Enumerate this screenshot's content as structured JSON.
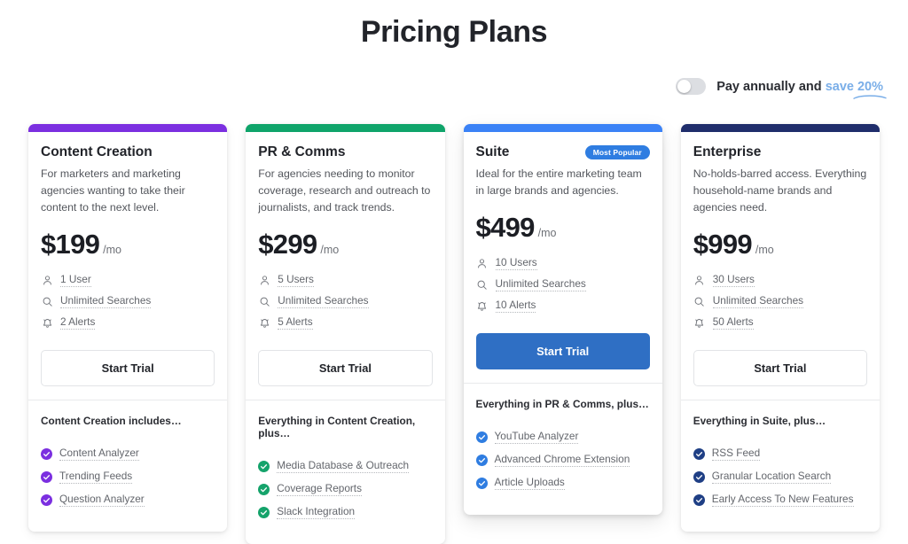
{
  "header": {
    "title": "Pricing Plans"
  },
  "billing": {
    "toggle_state": "off",
    "label_prefix": "Pay annually and",
    "save_text": "save 20%",
    "accent_color": "#7aaee8"
  },
  "plans": [
    {
      "id": "content-creation",
      "name": "Content Creation",
      "badge": null,
      "accent_color": "#7b2fe0",
      "check_color": "#7b2fe0",
      "description": "For marketers and marketing agencies wanting to take their content to the next level.",
      "price": "$199",
      "period": "/mo",
      "specs": [
        {
          "icon": "user-icon",
          "label": "1 User"
        },
        {
          "icon": "search-icon",
          "label": "Unlimited Searches"
        },
        {
          "icon": "bell-icon",
          "label": "2 Alerts"
        }
      ],
      "cta_label": "Start Trial",
      "cta_style": "outline",
      "includes_title": "Content Creation includes…",
      "features": [
        "Content Analyzer",
        "Trending Feeds",
        "Question Analyzer"
      ]
    },
    {
      "id": "pr-and-comms",
      "name": "PR & Comms",
      "badge": null,
      "accent_color": "#0fa46a",
      "check_color": "#15a36b",
      "description": "For agencies needing to monitor coverage, research and outreach to journalists, and track trends.",
      "price": "$299",
      "period": "/mo",
      "specs": [
        {
          "icon": "user-icon",
          "label": "5 Users"
        },
        {
          "icon": "search-icon",
          "label": "Unlimited Searches"
        },
        {
          "icon": "bell-icon",
          "label": "5 Alerts"
        }
      ],
      "cta_label": "Start Trial",
      "cta_style": "outline",
      "includes_title": "Everything in Content Creation, plus…",
      "features": [
        "Media Database & Outreach",
        "Coverage Reports",
        "Slack Integration"
      ]
    },
    {
      "id": "suite",
      "name": "Suite",
      "badge": "Most Popular",
      "accent_color": "#3b82f6",
      "check_color": "#2f7de1",
      "description": "Ideal for the entire marketing team in large brands and agencies.",
      "price": "$499",
      "period": "/mo",
      "specs": [
        {
          "icon": "user-icon",
          "label": "10 Users"
        },
        {
          "icon": "search-icon",
          "label": "Unlimited Searches"
        },
        {
          "icon": "bell-icon",
          "label": "10 Alerts"
        }
      ],
      "cta_label": "Start Trial",
      "cta_style": "filled",
      "includes_title": "Everything in PR & Comms, plus…",
      "features": [
        "YouTube Analyzer",
        "Advanced Chrome Extension",
        "Article Uploads"
      ]
    },
    {
      "id": "enterprise",
      "name": "Enterprise",
      "badge": null,
      "accent_color": "#1f2d6b",
      "check_color": "#1f3f85",
      "description": "No-holds-barred access. Everything household-name brands and agencies need.",
      "price": "$999",
      "period": "/mo",
      "specs": [
        {
          "icon": "user-icon",
          "label": "30 Users"
        },
        {
          "icon": "search-icon",
          "label": "Unlimited Searches"
        },
        {
          "icon": "bell-icon",
          "label": "50 Alerts"
        }
      ],
      "cta_label": "Start Trial",
      "cta_style": "outline",
      "includes_title": "Everything in Suite, plus…",
      "features": [
        "RSS Feed",
        "Granular Location Search",
        "Early Access To New Features"
      ]
    }
  ]
}
